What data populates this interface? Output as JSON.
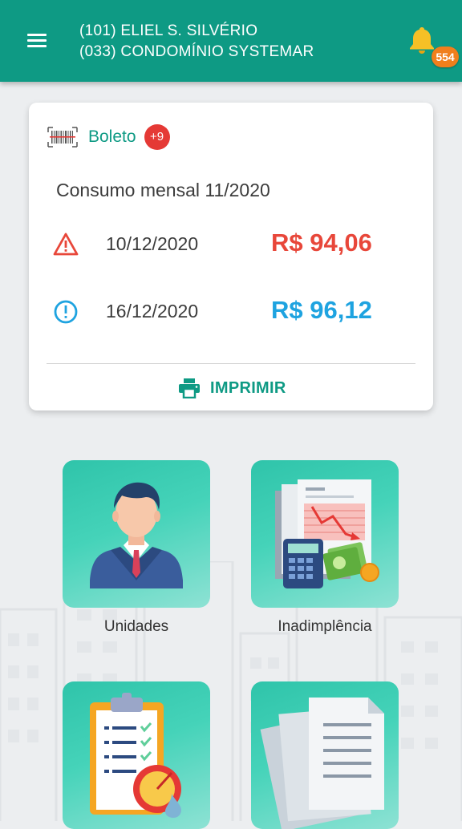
{
  "header": {
    "line1": "(101) ELIEL S. SILVÉRIO",
    "line2": "(033) CONDOMÍNIO SYSTEMAR",
    "notification_count": "554"
  },
  "boleto": {
    "title": "Boleto",
    "extra_count": "+9",
    "subtitle": "Consumo mensal 11/2020",
    "entries": [
      {
        "status_icon": "warning-icon",
        "date": "10/12/2020",
        "amount": "R$ 94,06",
        "color": "#e8473a"
      },
      {
        "status_icon": "info-icon",
        "date": "16/12/2020",
        "amount": "R$ 96,12",
        "color": "#1ea3e0"
      }
    ],
    "print_label": "IMPRIMIR"
  },
  "tiles": [
    {
      "label": "Unidades",
      "icon": "person-icon"
    },
    {
      "label": "Inadimplência",
      "icon": "finance-report-icon"
    },
    {
      "label": "",
      "icon": "checklist-icon"
    },
    {
      "label": "",
      "icon": "documents-icon"
    }
  ],
  "colors": {
    "primary": "#0e9a84",
    "overdue": "#e8473a",
    "pending": "#1ea3e0",
    "badge": "#f07f1c"
  }
}
